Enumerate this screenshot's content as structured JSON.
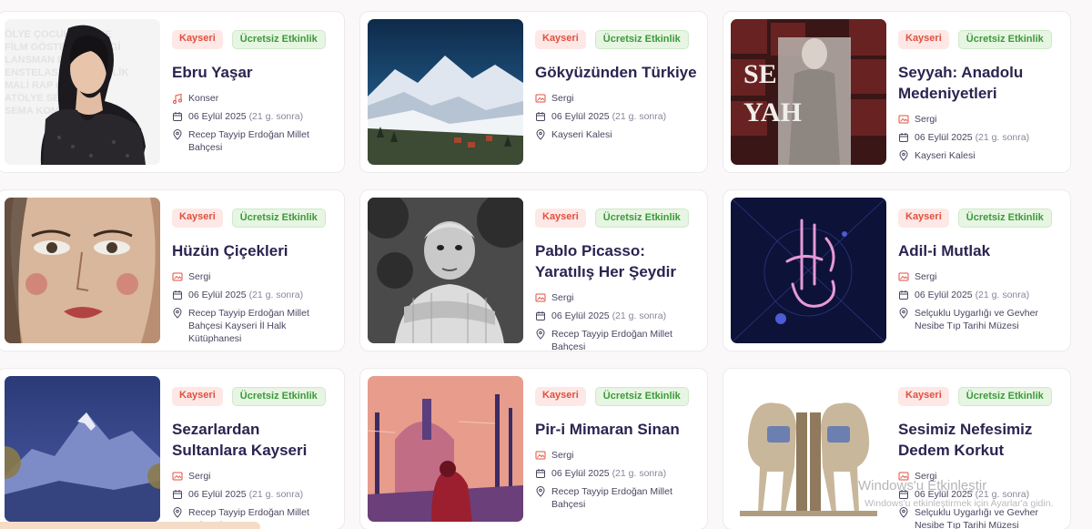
{
  "events": [
    {
      "city": "Kayseri",
      "free": "Ücretsiz Etkinlik",
      "title": "Ebru Yaşar",
      "category": "Konser",
      "category_icon": "music-icon",
      "date": "06 Eylül 2025",
      "relative": "(21 g. sonra)",
      "venue": "Recep Tayyip Erdoğan Millet Bahçesi"
    },
    {
      "city": "Kayseri",
      "free": "Ücretsiz Etkinlik",
      "title": "Gökyüzünden Türkiye",
      "category": "Sergi",
      "category_icon": "gallery-icon",
      "date": "06 Eylül 2025",
      "relative": "(21 g. sonra)",
      "venue": "Kayseri Kalesi"
    },
    {
      "city": "Kayseri",
      "free": "Ücretsiz Etkinlik",
      "title": "Seyyah: Anadolu Medeniyetleri",
      "category": "Sergi",
      "category_icon": "gallery-icon",
      "date": "06 Eylül 2025",
      "relative": "(21 g. sonra)",
      "venue": "Kayseri Kalesi"
    },
    {
      "city": "Kayseri",
      "free": "Ücretsiz Etkinlik",
      "title": "Hüzün Çiçekleri",
      "category": "Sergi",
      "category_icon": "gallery-icon",
      "date": "06 Eylül 2025",
      "relative": "(21 g. sonra)",
      "venue": "Recep Tayyip Erdoğan Millet Bahçesi Kayseri İl Halk Kütüphanesi"
    },
    {
      "city": "Kayseri",
      "free": "Ücretsiz Etkinlik",
      "title": "Pablo Picasso: Yaratılış Her Şeydir",
      "category": "Sergi",
      "category_icon": "gallery-icon",
      "date": "06 Eylül 2025",
      "relative": "(21 g. sonra)",
      "venue": "Recep Tayyip Erdoğan Millet Bahçesi"
    },
    {
      "city": "Kayseri",
      "free": "Ücretsiz Etkinlik",
      "title": "Adil-i Mutlak",
      "category": "Sergi",
      "category_icon": "gallery-icon",
      "date": "06 Eylül 2025",
      "relative": "(21 g. sonra)",
      "venue": "Selçuklu Uygarlığı ve Gevher Nesibe Tıp Tarihi Müzesi"
    },
    {
      "city": "Kayseri",
      "free": "Ücretsiz Etkinlik",
      "title": "Sezarlardan Sultanlara Kayseri",
      "category": "Sergi",
      "category_icon": "gallery-icon",
      "date": "06 Eylül 2025",
      "relative": "(21 g. sonra)",
      "venue": "Recep Tayyip Erdoğan Millet Bahçesi"
    },
    {
      "city": "Kayseri",
      "free": "Ücretsiz Etkinlik",
      "title": "Pir-i Mimaran Sinan",
      "category": "Sergi",
      "category_icon": "gallery-icon",
      "date": "06 Eylül 2025",
      "relative": "(21 g. sonra)",
      "venue": "Recep Tayyip Erdoğan Millet Bahçesi"
    },
    {
      "city": "Kayseri",
      "free": "Ücretsiz Etkinlik",
      "title": "Sesimiz Nefesimiz Dedem Korkut",
      "category": "Sergi",
      "category_icon": "gallery-icon",
      "date": "06 Eylül 2025",
      "relative": "(21 g. sonra)",
      "venue": "Selçuklu Uygarlığı ve Gevher Nesibe Tıp Tarihi Müzesi"
    }
  ],
  "os_watermark": {
    "line1": "Windows'u Etkinleştir",
    "line2": "Windows'u etkinleştirmek için Ayarlar'a gidin."
  },
  "colors": {
    "title": "#2b2350",
    "city_badge": "#e0503f",
    "free_badge": "#3c9a3a",
    "icon": "#e0503f"
  }
}
